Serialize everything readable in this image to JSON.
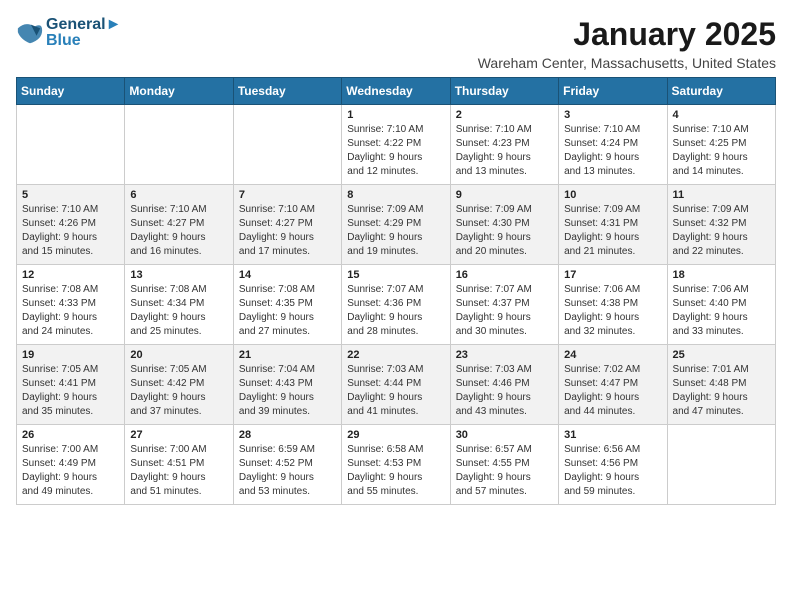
{
  "header": {
    "logo_line1": "General",
    "logo_line2": "Blue",
    "month": "January 2025",
    "location": "Wareham Center, Massachusetts, United States"
  },
  "weekdays": [
    "Sunday",
    "Monday",
    "Tuesday",
    "Wednesday",
    "Thursday",
    "Friday",
    "Saturday"
  ],
  "weeks": [
    [
      {
        "day": "",
        "info": ""
      },
      {
        "day": "",
        "info": ""
      },
      {
        "day": "",
        "info": ""
      },
      {
        "day": "1",
        "info": "Sunrise: 7:10 AM\nSunset: 4:22 PM\nDaylight: 9 hours\nand 12 minutes."
      },
      {
        "day": "2",
        "info": "Sunrise: 7:10 AM\nSunset: 4:23 PM\nDaylight: 9 hours\nand 13 minutes."
      },
      {
        "day": "3",
        "info": "Sunrise: 7:10 AM\nSunset: 4:24 PM\nDaylight: 9 hours\nand 13 minutes."
      },
      {
        "day": "4",
        "info": "Sunrise: 7:10 AM\nSunset: 4:25 PM\nDaylight: 9 hours\nand 14 minutes."
      }
    ],
    [
      {
        "day": "5",
        "info": "Sunrise: 7:10 AM\nSunset: 4:26 PM\nDaylight: 9 hours\nand 15 minutes."
      },
      {
        "day": "6",
        "info": "Sunrise: 7:10 AM\nSunset: 4:27 PM\nDaylight: 9 hours\nand 16 minutes."
      },
      {
        "day": "7",
        "info": "Sunrise: 7:10 AM\nSunset: 4:27 PM\nDaylight: 9 hours\nand 17 minutes."
      },
      {
        "day": "8",
        "info": "Sunrise: 7:09 AM\nSunset: 4:29 PM\nDaylight: 9 hours\nand 19 minutes."
      },
      {
        "day": "9",
        "info": "Sunrise: 7:09 AM\nSunset: 4:30 PM\nDaylight: 9 hours\nand 20 minutes."
      },
      {
        "day": "10",
        "info": "Sunrise: 7:09 AM\nSunset: 4:31 PM\nDaylight: 9 hours\nand 21 minutes."
      },
      {
        "day": "11",
        "info": "Sunrise: 7:09 AM\nSunset: 4:32 PM\nDaylight: 9 hours\nand 22 minutes."
      }
    ],
    [
      {
        "day": "12",
        "info": "Sunrise: 7:08 AM\nSunset: 4:33 PM\nDaylight: 9 hours\nand 24 minutes."
      },
      {
        "day": "13",
        "info": "Sunrise: 7:08 AM\nSunset: 4:34 PM\nDaylight: 9 hours\nand 25 minutes."
      },
      {
        "day": "14",
        "info": "Sunrise: 7:08 AM\nSunset: 4:35 PM\nDaylight: 9 hours\nand 27 minutes."
      },
      {
        "day": "15",
        "info": "Sunrise: 7:07 AM\nSunset: 4:36 PM\nDaylight: 9 hours\nand 28 minutes."
      },
      {
        "day": "16",
        "info": "Sunrise: 7:07 AM\nSunset: 4:37 PM\nDaylight: 9 hours\nand 30 minutes."
      },
      {
        "day": "17",
        "info": "Sunrise: 7:06 AM\nSunset: 4:38 PM\nDaylight: 9 hours\nand 32 minutes."
      },
      {
        "day": "18",
        "info": "Sunrise: 7:06 AM\nSunset: 4:40 PM\nDaylight: 9 hours\nand 33 minutes."
      }
    ],
    [
      {
        "day": "19",
        "info": "Sunrise: 7:05 AM\nSunset: 4:41 PM\nDaylight: 9 hours\nand 35 minutes."
      },
      {
        "day": "20",
        "info": "Sunrise: 7:05 AM\nSunset: 4:42 PM\nDaylight: 9 hours\nand 37 minutes."
      },
      {
        "day": "21",
        "info": "Sunrise: 7:04 AM\nSunset: 4:43 PM\nDaylight: 9 hours\nand 39 minutes."
      },
      {
        "day": "22",
        "info": "Sunrise: 7:03 AM\nSunset: 4:44 PM\nDaylight: 9 hours\nand 41 minutes."
      },
      {
        "day": "23",
        "info": "Sunrise: 7:03 AM\nSunset: 4:46 PM\nDaylight: 9 hours\nand 43 minutes."
      },
      {
        "day": "24",
        "info": "Sunrise: 7:02 AM\nSunset: 4:47 PM\nDaylight: 9 hours\nand 44 minutes."
      },
      {
        "day": "25",
        "info": "Sunrise: 7:01 AM\nSunset: 4:48 PM\nDaylight: 9 hours\nand 47 minutes."
      }
    ],
    [
      {
        "day": "26",
        "info": "Sunrise: 7:00 AM\nSunset: 4:49 PM\nDaylight: 9 hours\nand 49 minutes."
      },
      {
        "day": "27",
        "info": "Sunrise: 7:00 AM\nSunset: 4:51 PM\nDaylight: 9 hours\nand 51 minutes."
      },
      {
        "day": "28",
        "info": "Sunrise: 6:59 AM\nSunset: 4:52 PM\nDaylight: 9 hours\nand 53 minutes."
      },
      {
        "day": "29",
        "info": "Sunrise: 6:58 AM\nSunset: 4:53 PM\nDaylight: 9 hours\nand 55 minutes."
      },
      {
        "day": "30",
        "info": "Sunrise: 6:57 AM\nSunset: 4:55 PM\nDaylight: 9 hours\nand 57 minutes."
      },
      {
        "day": "31",
        "info": "Sunrise: 6:56 AM\nSunset: 4:56 PM\nDaylight: 9 hours\nand 59 minutes."
      },
      {
        "day": "",
        "info": ""
      }
    ]
  ]
}
